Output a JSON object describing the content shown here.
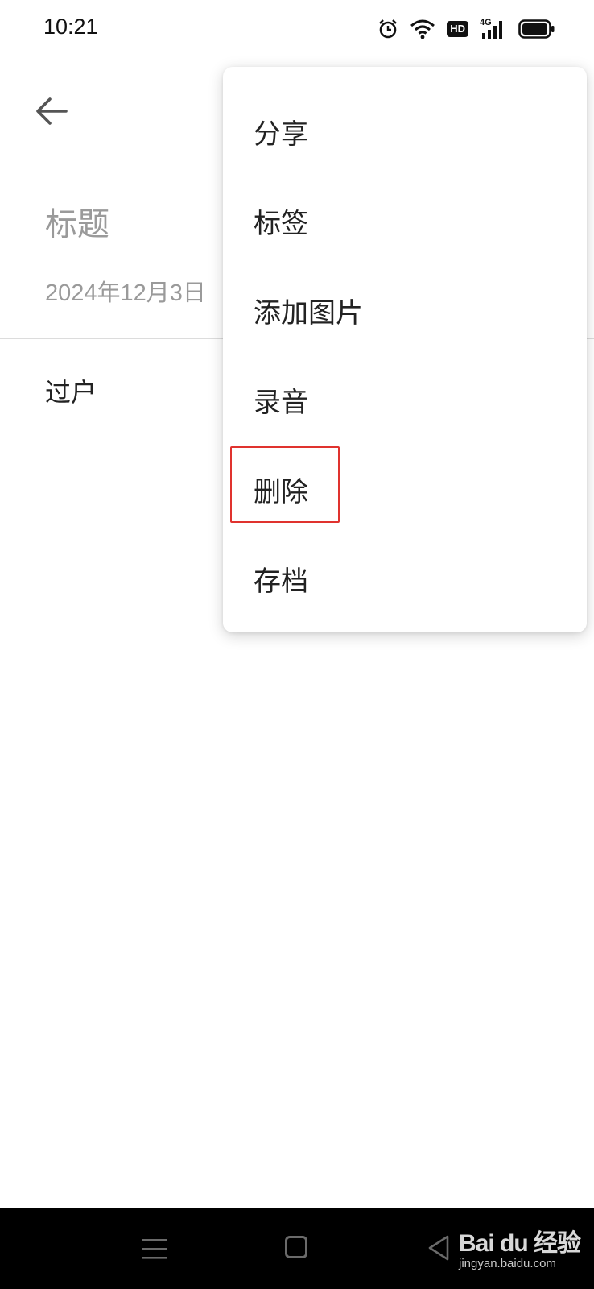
{
  "status_bar": {
    "time": "10:21",
    "hd_label": "HD",
    "network_label": "4G",
    "icons": [
      "alarm-icon",
      "wifi-icon",
      "hd-icon",
      "signal-icon",
      "battery-icon"
    ]
  },
  "header": {
    "back_icon": "arrow-left-icon"
  },
  "note": {
    "title_placeholder": "标题",
    "date": "2024年12月3日",
    "body": "过户"
  },
  "menu": {
    "items": [
      {
        "label": "分享"
      },
      {
        "label": "标签"
      },
      {
        "label": "添加图片"
      },
      {
        "label": "录音"
      },
      {
        "label": "删除",
        "highlighted": true
      },
      {
        "label": "存档"
      }
    ],
    "highlight_color": "#e0322e"
  },
  "nav_bar": {
    "icons": [
      "menu-icon",
      "home-icon",
      "back-triangle-icon"
    ]
  },
  "watermark": {
    "logo": "Bai du 经验",
    "url": "jingyan.baidu.com"
  }
}
